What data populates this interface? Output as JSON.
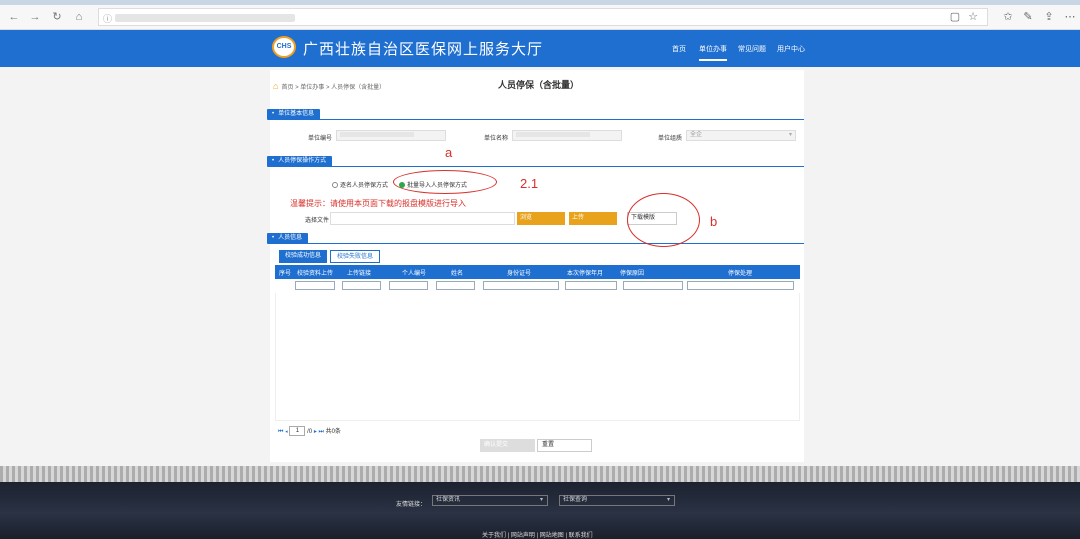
{
  "site": {
    "logo_text": "CHS",
    "title": "广西壮族自治区医保网上服务大厅",
    "nav": [
      "首页",
      "单位办事",
      "常见问题",
      "用户中心"
    ],
    "active_nav_index": 1
  },
  "breadcrumb": "首页 > 单位办事 > 人员停保（含批量）",
  "page_title": "人员停保（含批量）",
  "sections": {
    "unit_info": "单位基本信息",
    "operation_mode": "人员停保操作方式",
    "personnel_info": "人员信息"
  },
  "unit_info": {
    "unit_code_label": "单位编号",
    "unit_name_label": "单位名称",
    "unit_type_label": "单位组质",
    "unit_type_value": "全企"
  },
  "operation_mode": {
    "option_single": "逐名人员停保方式",
    "option_batch": "批量导入人员停保方式",
    "selected": "batch"
  },
  "hint": "温馨提示：请使用本页面下载的报盘模版进行导入",
  "file": {
    "label": "选择文件",
    "browse": "浏览",
    "upload": "上传",
    "download_template": "下载模版"
  },
  "tabs": [
    "校验成功信息",
    "校验失败信息"
  ],
  "active_tab_index": 0,
  "table": {
    "columns": [
      "序号",
      "校验资料上传",
      "上传链接",
      "个人编号",
      "姓名",
      "身份证号",
      "本次停保年月",
      "停保原因",
      "停保处理"
    ]
  },
  "pager": {
    "page_value": "1",
    "total_pages_text": "/0",
    "total_count_text": "共0条"
  },
  "actions": {
    "submit": "确认提交",
    "reset": "重置"
  },
  "annotations": {
    "a": "a",
    "step": "2.1",
    "b": "b",
    "color": "#d8302a"
  },
  "footer": {
    "friends_label": "友情链接：",
    "select1": "社保资讯",
    "select2": "社保查询",
    "links": "关于我们 | 网站声明 | 网站地图 | 联系我们"
  },
  "colors": {
    "primary": "#1f6fd0",
    "accent": "#e8a21c",
    "success": "#2aa84a"
  }
}
